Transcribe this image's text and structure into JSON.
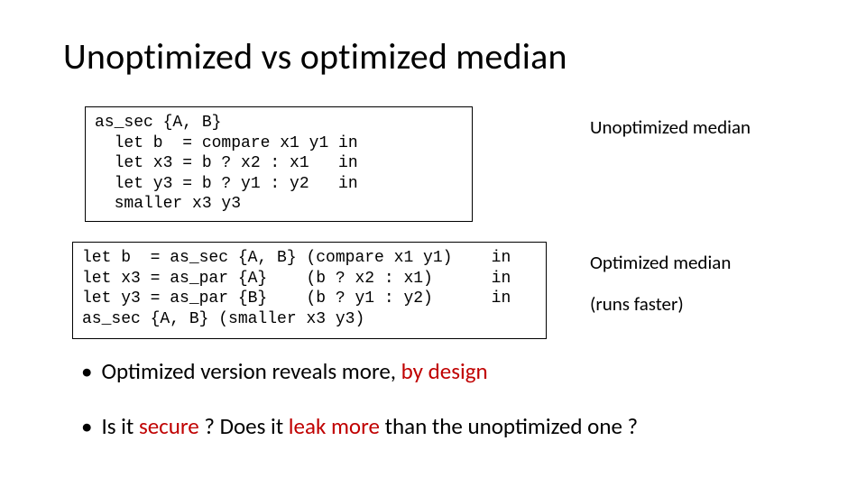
{
  "title": "Unoptimized vs optimized median",
  "code1": "as_sec {A, B}\n  let b  = compare x1 y1 in\n  let x3 = b ? x2 : x1   in\n  let y3 = b ? y1 : y2   in\n  smaller x3 y3",
  "code2": "let b  = as_sec {A, B} (compare x1 y1)    in\nlet x3 = as_par {A}    (b ? x2 : x1)      in\nlet y3 = as_par {B}    (b ? y1 : y2)      in\nas_sec {A, B} (smaller x3 y3)",
  "labels": {
    "unopt": "Unoptimized median",
    "opt": "Optimized median",
    "runs": "(runs faster)"
  },
  "bullets": {
    "b1_pre": "Optimized version reveals more, ",
    "b1_hl": "by design",
    "b2_pre": "Is it ",
    "b2_hl1": "secure",
    "b2_mid": " ? Does it ",
    "b2_hl2": "leak more",
    "b2_post": " than the unoptimized one ?"
  }
}
